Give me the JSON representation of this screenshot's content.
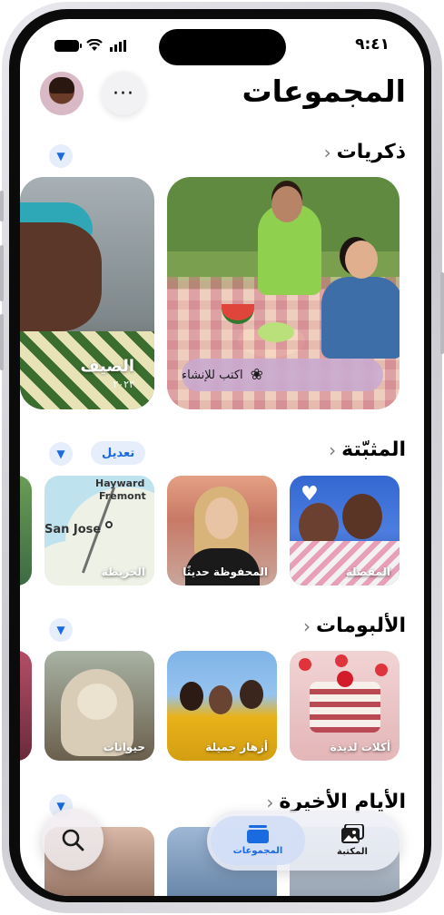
{
  "status_bar": {
    "time": "٩:٤١"
  },
  "header": {
    "title": "المجموعات",
    "more_label": "···"
  },
  "sections": {
    "memories": {
      "title": "ذكريات",
      "chevron": "‹"
    },
    "pinned": {
      "title": "المثبّتة",
      "chevron": "‹",
      "edit_label": "تعديل"
    },
    "albums": {
      "title": "الألبومات",
      "chevron": "‹"
    },
    "recent_days": {
      "title": "الأيام الأخيرة",
      "chevron": "‹"
    }
  },
  "memories": {
    "create_label": "اكتب للإنشاء",
    "second_title": "الصيف",
    "second_subtitle": "٢٠٢٢"
  },
  "pinned": {
    "items": [
      {
        "label": "المفضلة"
      },
      {
        "label": "المحفوظة حديثًا"
      },
      {
        "label": "الخريطة"
      }
    ],
    "map_labels": {
      "hayward": "Hayward",
      "fremont": "Fremont",
      "san_jose": "San Jose"
    }
  },
  "albums": {
    "items": [
      {
        "label": "أكلات لذيذة"
      },
      {
        "label": "أزهار جميلة"
      },
      {
        "label": "حيوانات"
      }
    ]
  },
  "tabbar": {
    "collections_label": "المجموعات",
    "library_label": "المكتبة"
  },
  "colors": {
    "accent": "#1a6ae0"
  },
  "icons": {
    "more": "ellipsis-icon",
    "collapse": "chevron-down-icon",
    "create": "sparkle-flower-icon",
    "favorite": "heart-icon",
    "search": "search-icon",
    "collections": "stacked-collections-icon",
    "library": "photo-library-icon"
  }
}
